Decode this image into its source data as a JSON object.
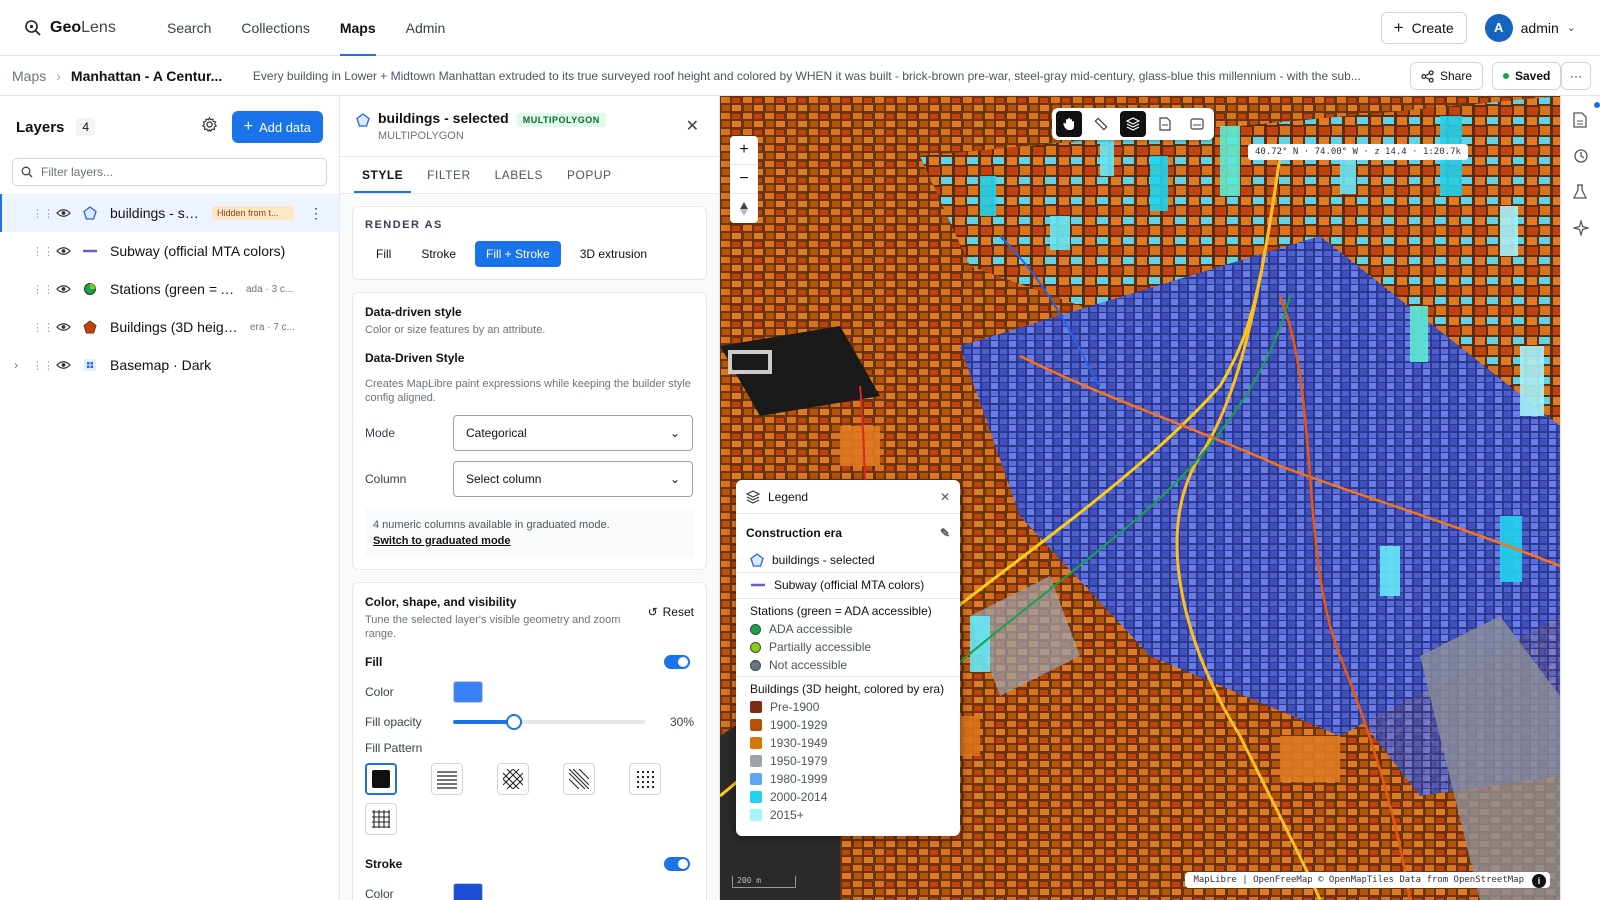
{
  "app": {
    "name_bold": "Geo",
    "name_rest": "Lens"
  },
  "nav": [
    {
      "label": "Search",
      "active": false
    },
    {
      "label": "Collections",
      "active": false
    },
    {
      "label": "Maps",
      "active": true
    },
    {
      "label": "Admin",
      "active": false
    }
  ],
  "topbar": {
    "create_label": "Create",
    "avatar_letter": "A",
    "user": "admin"
  },
  "breadcrumb": {
    "root": "Maps",
    "current": "Manhattan - A Centur...",
    "description": "Every building in Lower + Midtown Manhattan extruded to its true surveyed roof height and colored by WHEN it was built - brick-brown pre-war, steel-gray mid-century, glass-blue this millennium - with the sub...",
    "share_label": "Share",
    "saved_label": "Saved"
  },
  "layers_panel": {
    "title": "Layers",
    "count": "4",
    "add_label": "Add data",
    "filter_placeholder": "Filter layers...",
    "rows": [
      {
        "name": "buildings - se...",
        "badge": "Hidden from t...",
        "tag": ""
      },
      {
        "name": "Subway (official MTA colors)",
        "badge": "",
        "tag": ""
      },
      {
        "name": "Stations (green = A...",
        "badge": "",
        "tag": "ada · 3 c..."
      },
      {
        "name": "Buildings (3D heigh...",
        "badge": "",
        "tag": "era · 7 c..."
      },
      {
        "name": "Basemap · Dark",
        "badge": "",
        "tag": ""
      }
    ]
  },
  "style_panel": {
    "title": "buildings - selected",
    "geom_pill": "MULTIPOLYGON",
    "geom_sub": "MULTIPOLYGON",
    "tabs": [
      "STYLE",
      "FILTER",
      "LABELS",
      "POPUP"
    ],
    "render_as": {
      "heading": "RENDER AS",
      "options": [
        "Fill",
        "Stroke",
        "Fill + Stroke",
        "3D extrusion"
      ],
      "selected": "Fill + Stroke"
    },
    "ddstyle": {
      "title": "Data-driven style",
      "subtitle": "Color or size features by an attribute.",
      "title2": "Data-Driven Style",
      "desc2": "Creates MapLibre paint expressions while keeping the builder style config aligned.",
      "mode_label": "Mode",
      "mode_value": "Categorical",
      "column_label": "Column",
      "column_value": "Select column",
      "hint": "4 numeric columns available in graduated mode.",
      "hint_link": "Switch to graduated mode"
    },
    "csv": {
      "title": "Color, shape, and visibility",
      "subtitle": "Tune the selected layer's visible geometry and zoom range.",
      "reset_label": "Reset",
      "fill_label": "Fill",
      "fill_on": true,
      "color_label": "Color",
      "fill_color": "#3b82f6",
      "opacity_label": "Fill opacity",
      "opacity_value": "30%",
      "opacity_fraction": 0.32,
      "pattern_label": "Fill Pattern",
      "stroke_label": "Stroke",
      "stroke_on": true,
      "stroke_color_label": "Color",
      "stroke_color": "#1d4ed8"
    }
  },
  "map": {
    "coords": "40.72° N · 74.00° W · z 14.4 · 1:20.7k",
    "attribution": "MapLibre | OpenFreeMap © OpenMapTiles Data from OpenStreetMap",
    "scale": "200 m"
  },
  "legend": {
    "title": "Legend",
    "section_title": "Construction era",
    "layers": [
      {
        "name": "buildings - selected"
      },
      {
        "name": "Subway (official MTA colors)"
      }
    ],
    "stations": {
      "title": "Stations (green = ADA accessible)",
      "items": [
        {
          "label": "ADA accessible",
          "color": "#16a34a"
        },
        {
          "label": "Partially accessible",
          "color": "#84cc16"
        },
        {
          "label": "Not accessible",
          "color": "#6b7280"
        }
      ]
    },
    "buildings": {
      "title": "Buildings (3D height, colored by era)",
      "items": [
        {
          "label": "Pre-1900",
          "color": "#7c2d12"
        },
        {
          "label": "1900-1929",
          "color": "#b45309"
        },
        {
          "label": "1930-1949",
          "color": "#d97706"
        },
        {
          "label": "1950-1979",
          "color": "#9ca3af"
        },
        {
          "label": "1980-1999",
          "color": "#60a5fa"
        },
        {
          "label": "2000-2014",
          "color": "#22d3ee"
        },
        {
          "label": "2015+",
          "color": "#a5f3fc"
        }
      ]
    }
  },
  "colors": {
    "accent": "#1a73e8"
  }
}
